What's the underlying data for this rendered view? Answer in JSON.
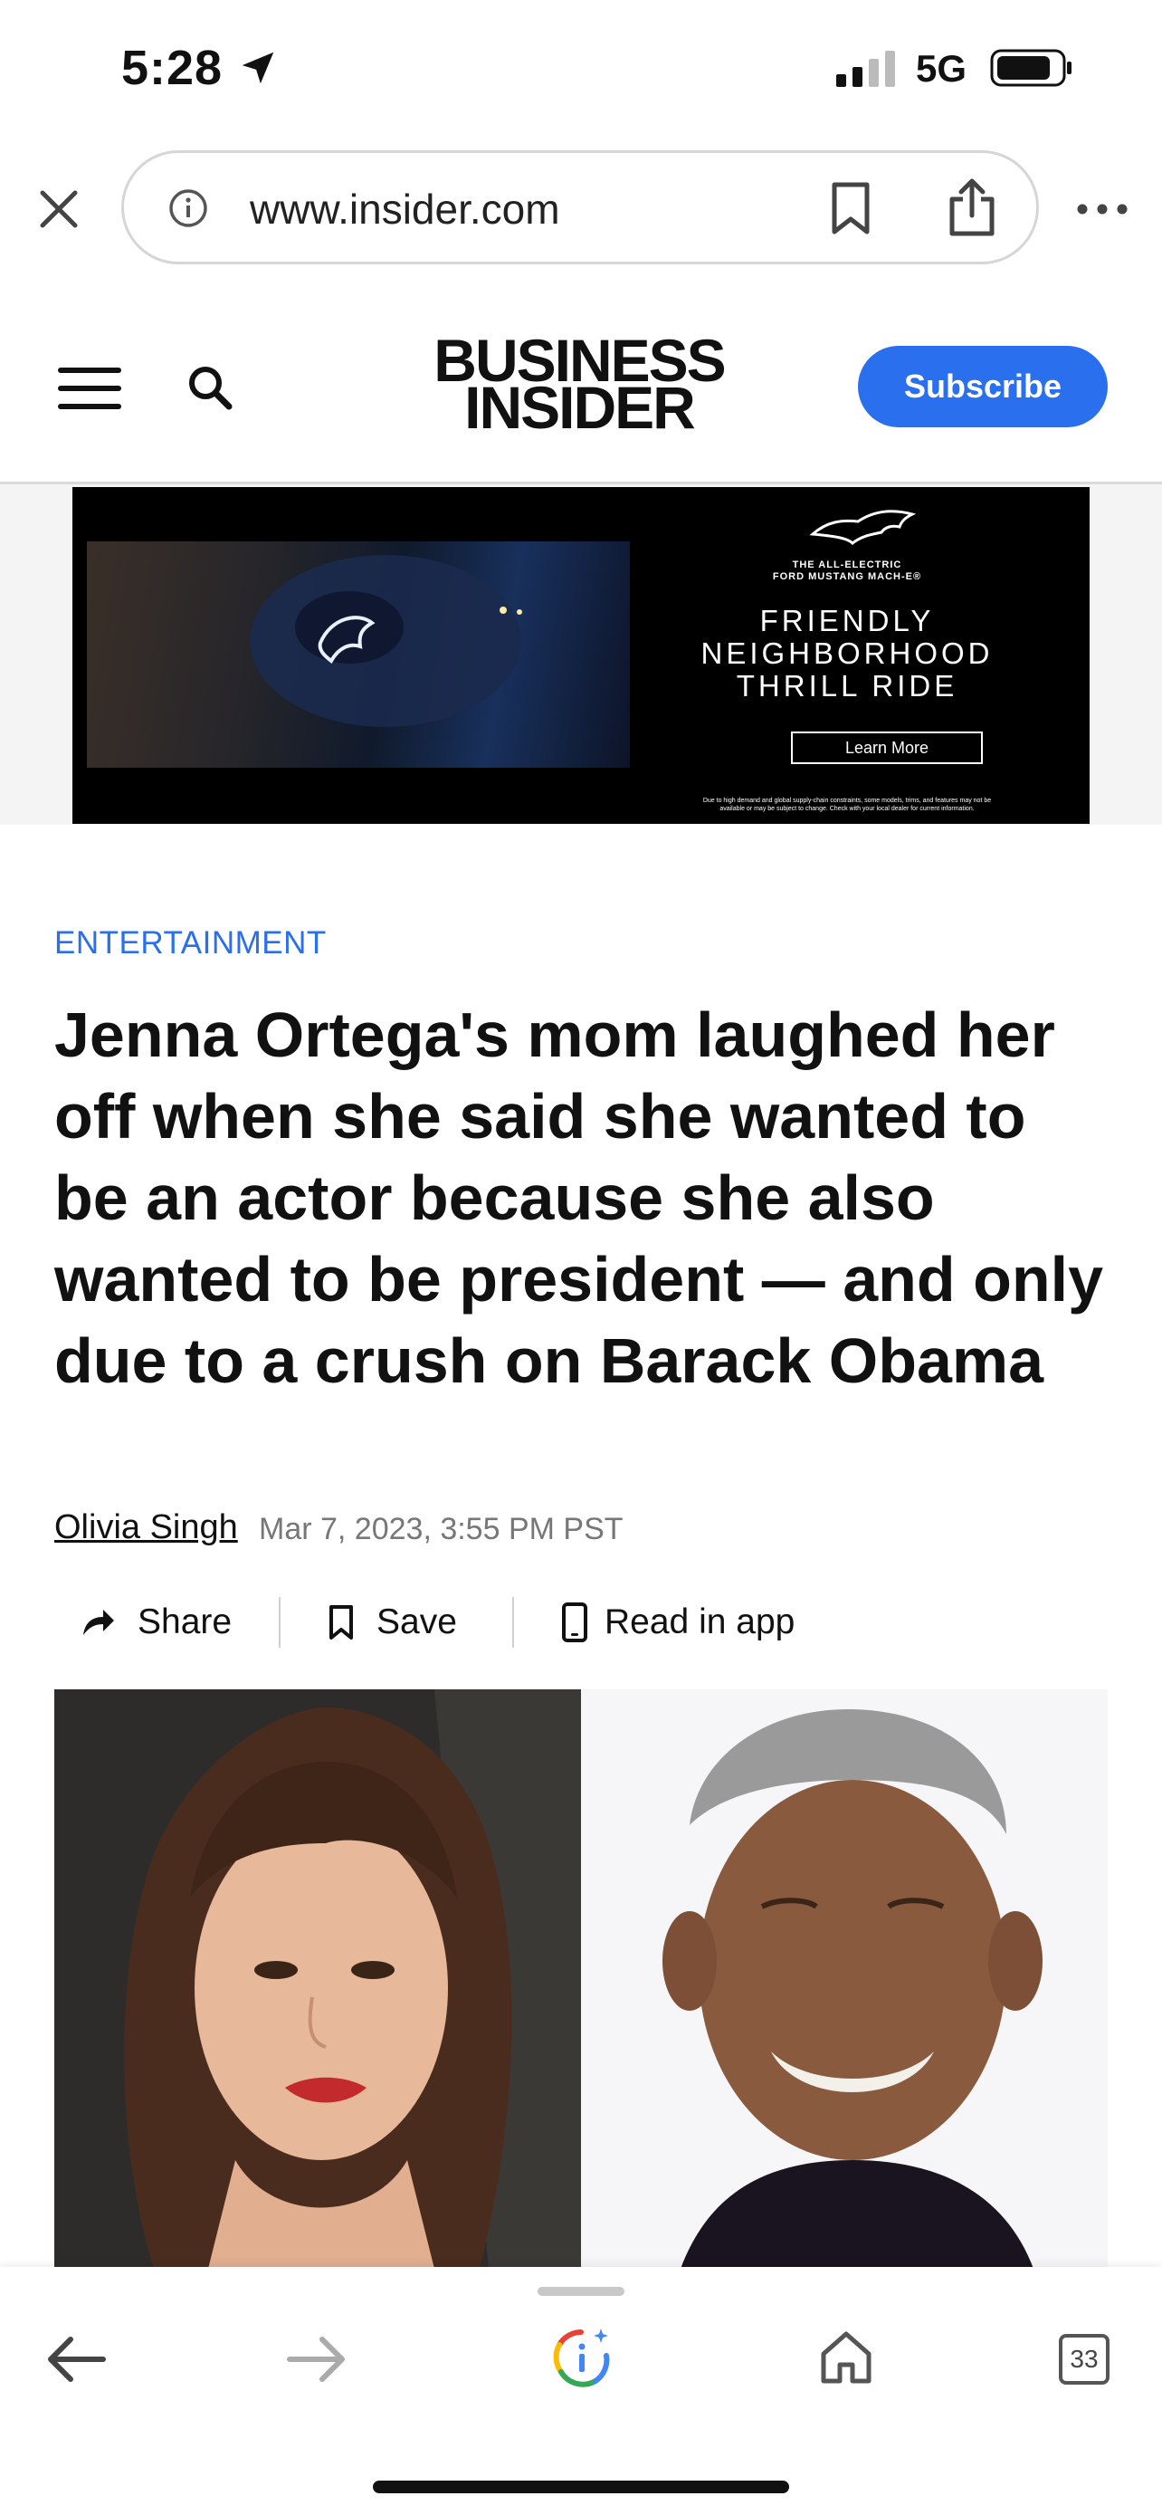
{
  "status_bar": {
    "time": "5:28",
    "network": "5G",
    "icons": [
      "location-arrow-icon",
      "signal-bars-icon",
      "battery-icon"
    ]
  },
  "browser": {
    "url": "www.insider.com",
    "icons": [
      "close-icon",
      "info-icon",
      "bookmark-icon",
      "share-icon",
      "more-icon"
    ]
  },
  "site_header": {
    "logo_line1": "BUSINESS",
    "logo_line2": "INSIDER",
    "subscribe_label": "Subscribe",
    "brand_color": "#2a6fed",
    "icons": [
      "hamburger-menu-icon",
      "search-icon"
    ]
  },
  "ad": {
    "tagline_line1": "THE ALL-ELECTRIC",
    "tagline_line2": "FORD MUSTANG MACH-E®",
    "headline_line1": "FRIENDLY",
    "headline_line2": "NEIGHBORHOOD",
    "headline_line3": "THRILL RIDE",
    "cta_label": "Learn More",
    "disclaimer": "Due to high demand and global supply-chain constraints, some models, trims, and features may not be available or may be subject to change. Check with your local dealer for current information."
  },
  "article": {
    "category": "ENTERTAINMENT",
    "headline": "Jenna Ortega's mom laughed her off when she said she wanted to be an actor because she also wanted to be president — and only due to a crush on Barack Obama",
    "author": "Olivia Singh",
    "date": "Mar 7, 2023, 3:55 PM PST",
    "actions": {
      "share": "Share",
      "save": "Save",
      "read_in_app": "Read in app"
    }
  },
  "toolbar": {
    "tab_count": "33",
    "icons": [
      "back-arrow-icon",
      "forward-arrow-icon",
      "google-assistant-icon",
      "home-icon",
      "tabs-icon"
    ]
  }
}
